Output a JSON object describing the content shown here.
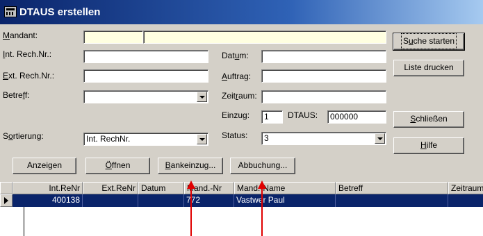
{
  "window": {
    "title": "DTAUS erstellen",
    "icon": "calculator-icon"
  },
  "labels": {
    "mandant": {
      "pre": "",
      "u": "M",
      "post": "andant:"
    },
    "int_rech": {
      "pre": "",
      "u": "I",
      "post": "nt. Rech.Nr.:"
    },
    "ext_rech": {
      "pre": "",
      "u": "E",
      "post": "xt. Rech.Nr.:"
    },
    "betreff": {
      "pre": "Betre",
      "u": "f",
      "post": "f:"
    },
    "sortierung": {
      "pre": "S",
      "u": "o",
      "post": "rtierung:"
    },
    "datum": {
      "pre": "Dat",
      "u": "u",
      "post": "m:"
    },
    "auftrag": {
      "pre": "",
      "u": "A",
      "post": "uftrag:"
    },
    "zeitraum": {
      "pre": "Zeit",
      "u": "r",
      "post": "aum:"
    },
    "einzug": "Einzug:",
    "dtaus": "DTAUS:",
    "status": "Status:"
  },
  "fields": {
    "mandant_nr": "",
    "mandant_name": "",
    "int_rech": "",
    "ext_rech": "",
    "betreff": "",
    "datum": "",
    "auftrag": "",
    "zeitraum": "",
    "einzug": "1",
    "dtaus": "000000",
    "sortierung": "Int. RechNr.",
    "status": "3"
  },
  "buttons": {
    "suche": {
      "pre": "S",
      "u": "u",
      "post": "che starten"
    },
    "liste": "Liste drucken",
    "schliessen": {
      "pre": "",
      "u": "S",
      "post": "chließen"
    },
    "hilfe": {
      "pre": "",
      "u": "H",
      "post": "ilfe"
    },
    "anzeigen": "Anzeigen",
    "oeffnen": {
      "pre": "",
      "u": "Ö",
      "post": "ffnen"
    },
    "bankeinzug": {
      "pre": "",
      "u": "B",
      "post": "ankeinzug..."
    },
    "abbuchung": "Abbuchung..."
  },
  "grid": {
    "columns": [
      "Int.ReNr",
      "Ext.ReNr",
      "Datum",
      "Mand.-Nr",
      "Mand.-Name",
      "Betreff",
      "Zeitraum"
    ],
    "rows": [
      {
        "int_renr": "400138",
        "ext_renr": "",
        "datum": "",
        "mand_nr": "772",
        "mand_name": "Vastwer Paul",
        "betreff": "",
        "zeitraum": ""
      }
    ]
  },
  "colors": {
    "selection": "#0a246a",
    "annotation_arrow": "#e00000",
    "highlight_field": "#ffffe1"
  }
}
